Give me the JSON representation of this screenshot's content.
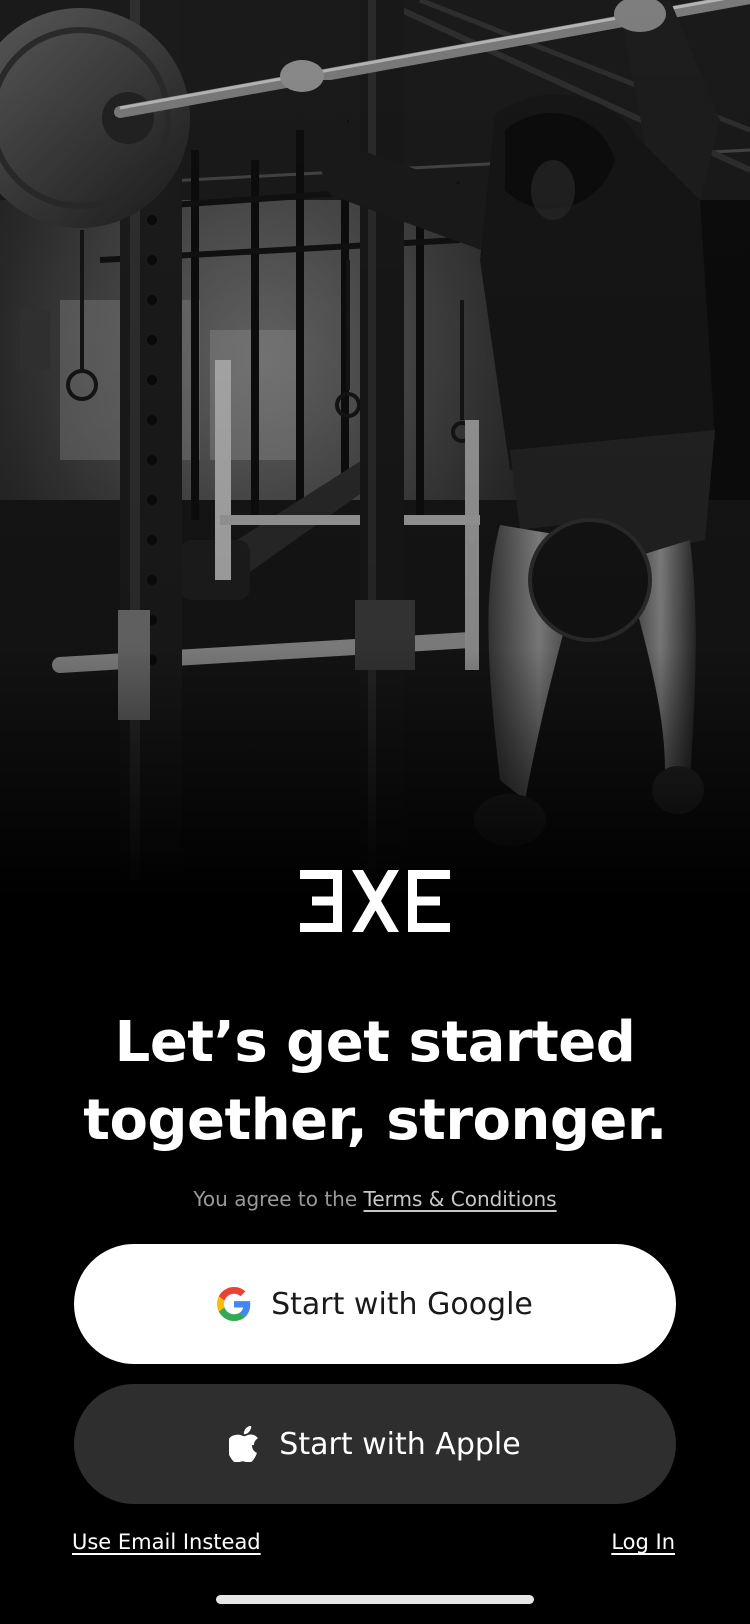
{
  "app": {
    "logo_name": "EXE"
  },
  "hero": {
    "description_icon": "gym-photo"
  },
  "headline": {
    "line1": "Let’s get started",
    "line2": "together, stronger."
  },
  "terms": {
    "prefix": "You agree to the ",
    "link": "Terms & Conditions"
  },
  "buttons": {
    "google": {
      "label": "Start with Google",
      "icon": "google-icon"
    },
    "apple": {
      "label": "Start with Apple",
      "icon": "apple-icon"
    }
  },
  "footer": {
    "email_link": "Use Email Instead",
    "login_link": "Log In"
  },
  "colors": {
    "background": "#000000",
    "google_button": "#ffffff",
    "apple_button": "#2e2e2e",
    "text_primary": "#ffffff",
    "text_muted": "#9a9a9a"
  }
}
